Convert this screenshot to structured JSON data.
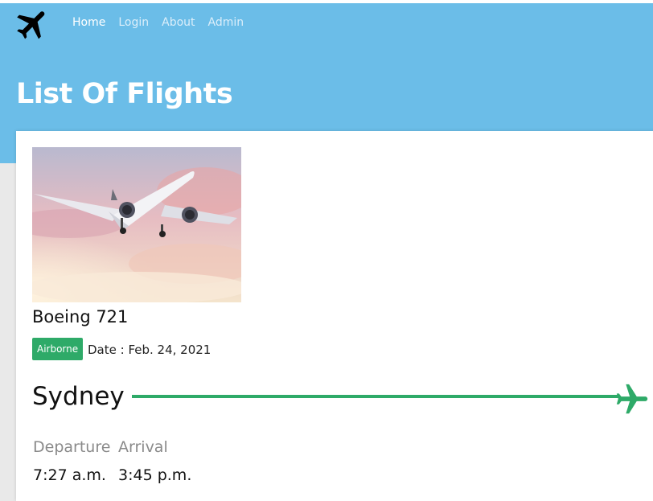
{
  "nav": {
    "logo_icon": "airplane-icon",
    "items": [
      {
        "label": "Home",
        "active": true
      },
      {
        "label": "Login",
        "active": false
      },
      {
        "label": "About",
        "active": false
      },
      {
        "label": "Admin",
        "active": false
      }
    ]
  },
  "page": {
    "title": "List Of Flights"
  },
  "flight": {
    "model": "Boeing 721",
    "status": "Airborne",
    "date": "Date : Feb. 24, 2021",
    "destination": "Sydney",
    "departure_label": "Departure",
    "arrival_label": "Arrival",
    "departure_time": "7:27 a.m.",
    "arrival_time": "3:45 p.m.",
    "route_icon": "airplane-icon"
  },
  "colors": {
    "header_bg": "#6bbde8",
    "accent_green": "#2eaa68",
    "page_bg": "#e9e9e9"
  }
}
